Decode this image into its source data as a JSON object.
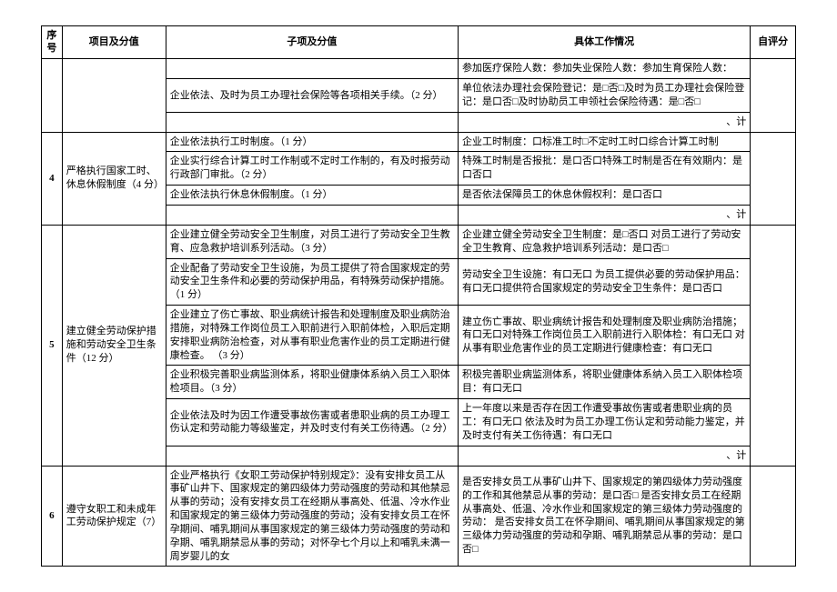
{
  "header": {
    "c0": "序号",
    "c1": "项目及分值",
    "c2": "子项及分值",
    "c3": "具体工作情况",
    "c4": "自评分"
  },
  "row_pre": {
    "d1": "参加医疗保险人数：参加失业保险人数：参加生育保险人数：",
    "s1": "企业依法、及时为员工办理社会保险等各项相关手续。（2 分）",
    "d2": "单位依法办理社会保险登记：是□否□及时为员工办理社会保险登记：是口否□及时协助员工申领社会保险待遇：是□否□",
    "sum": "、计"
  },
  "row4": {
    "num": "4",
    "proj": "严格执行国家工时、休息休假制度（4 分）",
    "s1": "企业依法执行工时制度。（1 分）",
    "d1": "企业工时制度：口标准工时□不定时工时口综合计算工时制",
    "s2": "企业实行综合计算工时工作制或不定时工作制的，有及时报劳动行政部门审批。（2 分）",
    "d2": "特殊工时制是否报批：是口否口特殊工时制是否在有效期内：是口否口",
    "s3": "企业依法执行休息休假制度。（1 分）",
    "d3": "是否依法保障员工的休息休假权利：是口否口",
    "sum": "、计"
  },
  "row5": {
    "num": "5",
    "proj": "建立健全劳动保护措施和劳动安全卫生条件（12 分）",
    "s1": "企业建立健全劳动安全卫生制度，对员工进行了劳动安全卫生教育、应急救护培训系列活动。（3 分）",
    "d1": "企业建立健全劳动安全卫生制度：是□否口\n对员工进行了劳动安全卫生教育、应急救护培训系列活动：是口否□",
    "s2": "企业配备了劳动安全卫生设施，为员工提供了符合国家规定的劳动安全卫生条件和必要的劳动保护用品，有特殊劳动保护措施。（1 分）",
    "d2": "劳动安全卫生设施：有口无口\n为员工提供必要的劳动保护用品：有口无口提供符合国家规定的劳动安全卫生条件：是口否口",
    "s3": "企业建立了伤亡事故、职业病统计报告和处理制度及职业病防治措施，对特殊工作岗位员工入职前进行入职前体检，入职后定期安排职业病防治检查，对从事有职业危害作业的员工定期进行健康检查。\n（3 分）",
    "d3": "建立伤亡事故、职业病统计报告和处理制度及职业病防治措施；有口无口对特殊工作岗位员工入职前进行入职体检：有口无口\n对从事有职业危害作业的员工定期进行健康检查：有口无口",
    "s4": "企业积极完善职业病监测体系，将职业健康体系纳入员工入职体检项目。（3 分）",
    "d4": "积极完善职业病监测体系，将职业健康体系纳入员工入职体检项目：有口无口",
    "s5": "企业依法及时为因工作遭受事故伤害或者患职业病的员工办理工伤认定和劳动能力等级鉴定，并及时支付有关工伤待遇。（2 分）",
    "d5": "上一年度以来是否存在因工作遭受事故伤害或者患职业病的员工：有口无口\n依法及时为员工办理工伤认定和劳动能力鉴定，并及时支付有关工伤待遇：有口无口",
    "sum": "、计"
  },
  "row6": {
    "num": "6",
    "proj": "遵守女职工和未成年工劳动保护规定（7）",
    "sub": "企业严格执行《女职工劳动保护特别规定》：没有安排女员工从事矿山井下、国家规定的第四级体力劳动强度的劳动和其他禁忌从事的劳动；没有安排女员工在经期从事高处、低温、冷水作业和国家规定的第三级体力劳动强度的劳动；没有安排女员工在怀孕期间、哺乳期间从事国家规定的第三级体力劳动强度的劳动和孕期、哺乳期禁忌从事的劳动；对怀孕七个月以上和哺乳未满一周岁婴儿的女",
    "det": "是否安排女员工从事矿山井下、国家规定的第四级体力劳动强度的工作和其他禁忌从事的劳动：是口否□\n是否安排女员工在经期从事高处、低温、冷水作业和国家规定的第三级体力劳动强度的劳动：\n是否安排女员工在怀孕期间、哺乳期间从事国家规定的第三级体力劳动强度的劳动和孕期、哺乳期禁忌从事的劳动：是口否□"
  }
}
